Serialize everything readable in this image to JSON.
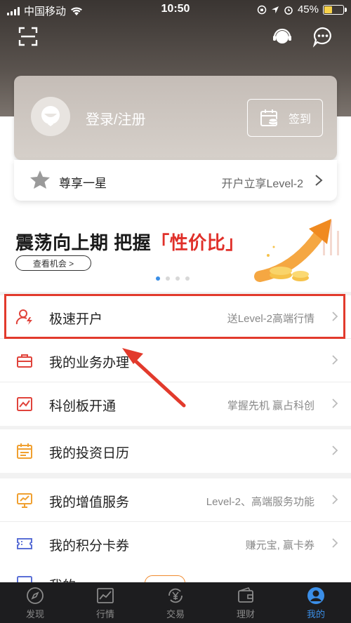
{
  "status_bar": {
    "carrier": "中国移动",
    "time": "10:50",
    "battery": "45%",
    "battery_level": 0.45
  },
  "login_card": {
    "login_text": "登录/注册",
    "signin_label": "签到"
  },
  "level_strip": {
    "left_text": "尊享一星",
    "right_text": "开户立享Level-2"
  },
  "banner": {
    "title_main": "震荡向上期 把握",
    "title_highlight": "「性价比」",
    "button_label": "查看机会 >",
    "slide_count": 4,
    "active_slide": 0
  },
  "menu": {
    "group1": [
      {
        "label": "极速开户",
        "sub": "送Level-2高端行情",
        "icon": "user-fast-icon",
        "color": "#e0433b"
      },
      {
        "label": "我的业务办理",
        "sub": "",
        "icon": "briefcase-icon",
        "color": "#e0433b"
      },
      {
        "label": "科创板开通",
        "sub": "掌握先机 赢占科创",
        "icon": "chart-board-icon",
        "color": "#e0433b"
      }
    ],
    "group2": [
      {
        "label": "我的投资日历",
        "sub": "",
        "icon": "calendar-icon",
        "color": "#f0a030"
      }
    ],
    "group3": [
      {
        "label": "我的增值服务",
        "sub": "Level-2、高端服务功能",
        "icon": "monitor-chart-icon",
        "color": "#f0a030"
      },
      {
        "label": "我的积分卡券",
        "sub": "赚元宝, 赢卡券",
        "icon": "ticket-icon",
        "color": "#5a6fd6"
      }
    ],
    "partial": {
      "label": "我的",
      "sub": ""
    }
  },
  "tabbar": [
    {
      "label": "发现",
      "icon": "compass-icon",
      "active": false
    },
    {
      "label": "行情",
      "icon": "trend-icon",
      "active": false
    },
    {
      "label": "交易",
      "icon": "yen-exchange-icon",
      "active": false
    },
    {
      "label": "理财",
      "icon": "wallet-icon",
      "active": false
    },
    {
      "label": "我的",
      "icon": "person-icon",
      "active": true
    }
  ],
  "colors": {
    "accent": "#3b8fe8",
    "highlight": "#e23a2c",
    "tabbar_bg": "#1d1d1f"
  }
}
